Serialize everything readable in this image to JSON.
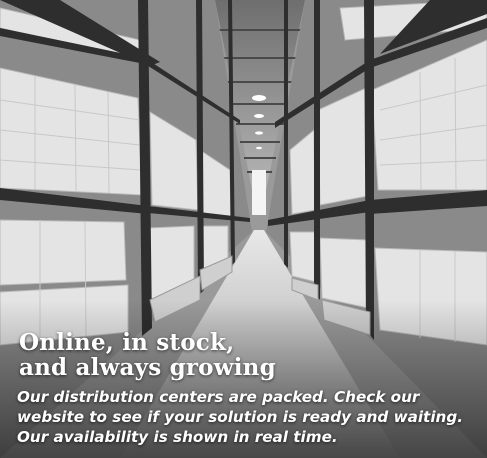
{
  "promo": {
    "headline_line1": "Online, in stock,",
    "headline_line2": "and always growing",
    "body": "Our distribution centers are packed. Check our website to see if your solution is ready and waiting. Our availability is shown in real time."
  },
  "image": {
    "subject": "warehouse-aisle-photo"
  },
  "colors": {
    "text": "#ffffff",
    "floor": "#c8c8c8",
    "boxes": "#e6e6e6",
    "rack": "#3a3a3a"
  }
}
